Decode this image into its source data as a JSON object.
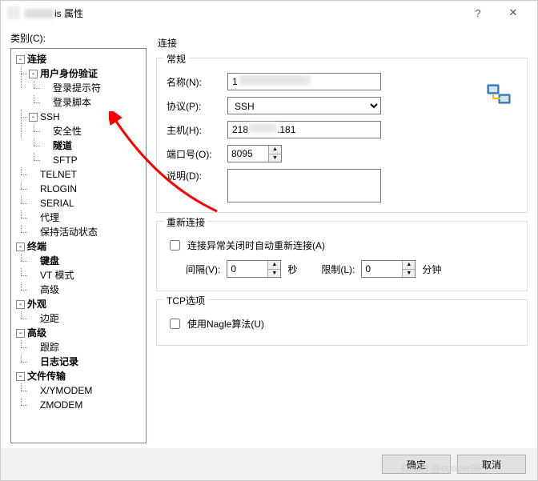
{
  "titlebar": {
    "suffix": "is 属性",
    "help_aria": "help",
    "close_aria": "close"
  },
  "category_label": "类别(C):",
  "tree": {
    "connection": "连接",
    "user_auth": "用户身份验证",
    "login_prompt": "登录提示符",
    "login_script": "登录脚本",
    "ssh": "SSH",
    "security": "安全性",
    "tunnel": "隧道",
    "sftp": "SFTP",
    "telnet": "TELNET",
    "rlogin": "RLOGIN",
    "serial": "SERIAL",
    "proxy": "代理",
    "keepalive": "保持活动状态",
    "terminal": "终端",
    "keyboard": "键盘",
    "vt": "VT 模式",
    "advanced_t": "高级",
    "appearance": "外观",
    "margin": "边距",
    "advanced": "高级",
    "trace": "跟踪",
    "logging": "日志记录",
    "file_transfer": "文件传输",
    "xymodem": "X/YMODEM",
    "zmodem": "ZMODEM"
  },
  "page_title": "连接",
  "general": {
    "legend": "常规",
    "name_label": "名称(N):",
    "name_value_prefix": "1",
    "protocol_label": "协议(P):",
    "protocol_value": "SSH",
    "host_label": "主机(H):",
    "host_value_p1": "218",
    "host_value_p2": ".181",
    "port_label": "端口号(O):",
    "port_value": "8095",
    "desc_label": "说明(D):",
    "desc_value": ""
  },
  "reconnect": {
    "legend": "重新连接",
    "auto_label": "连接异常关闭时自动重新连接(A)",
    "interval_label": "间隔(V):",
    "interval_value": "0",
    "sec": "秒",
    "limit_label": "限制(L):",
    "limit_value": "0",
    "min": "分钟"
  },
  "tcp": {
    "legend": "TCP选项",
    "nagle_label": "使用Nagle算法(U)"
  },
  "footer": {
    "ok": "确定",
    "cancel": "取消"
  },
  "watermark": "CSDN @cooper96"
}
